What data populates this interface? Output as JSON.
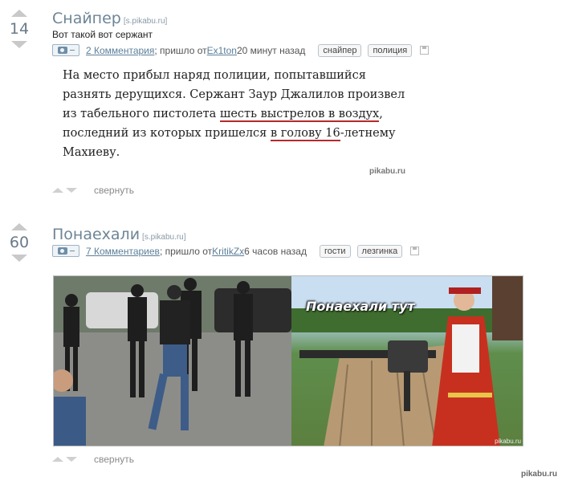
{
  "posts": [
    {
      "rating": "14",
      "title": "Снайпер",
      "source": "[s.pikabu.ru]",
      "subtitle": "Вот такой вот сержант",
      "comments": "2 Комментария",
      "meta_from": "; пришло от ",
      "author": "Ex1ton",
      "time": " 20 минут назад",
      "tags": [
        "снайпер",
        "полиция"
      ],
      "body": {
        "p1": "На место прибыл наряд полиции, попытавшийся разнять дерущихся. Сержант Заур Джалилов произвел из табельного пистолета ",
        "u1": "шесть выстрелов в воздух",
        "p2": ", последний из которых пришелся ",
        "u2": "в голову 16",
        "p3": "-летнему Махиеву."
      },
      "watermark": "pikabu.ru",
      "collapse": "свернуть"
    },
    {
      "rating": "60",
      "title": "Понаехали",
      "source": "[s.pikabu.ru]",
      "comments": "7 Комментариев",
      "meta_from": "; пришло от ",
      "author": "KritikZx",
      "time": " 6 часов назад",
      "tags": [
        "гости",
        "лезгинка"
      ],
      "image_caption": "Понаехали тут",
      "image_watermark": "pikabu.ru",
      "collapse": "свернуть"
    }
  ],
  "footer_watermark": "pikabu.ru"
}
